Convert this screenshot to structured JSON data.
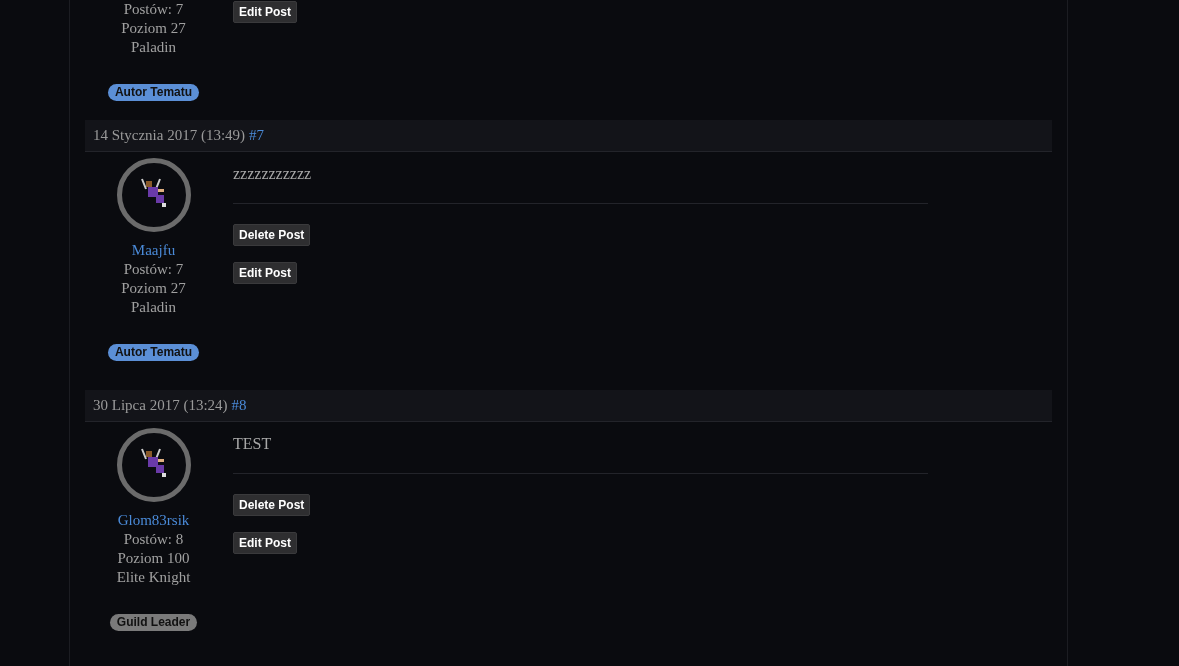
{
  "posts": [
    {
      "stats": [
        "Postów: 7",
        "Poziom 27",
        "Paladin"
      ],
      "badge": {
        "label": "Autor Tematu",
        "color": "#5b8fd6"
      },
      "actions": [
        "Edit Post"
      ]
    },
    {
      "date": "14 Stycznia 2017 (13:49)",
      "number": "#7",
      "author": "Maajfu",
      "stats": [
        "Postów: 7",
        "Poziom 27",
        "Paladin"
      ],
      "badge": {
        "label": "Autor Tematu",
        "color": "#5b8fd6"
      },
      "body": "zzzzzzzzzzz",
      "actions": [
        "Delete Post",
        "Edit Post"
      ]
    },
    {
      "date": "30 Lipca 2017 (13:24)",
      "number": "#8",
      "author": "Glom83rsik",
      "stats": [
        "Postów: 8",
        "Poziom 100",
        "Elite Knight"
      ],
      "badge": {
        "label": "Guild Leader",
        "color": "#7a7a7a"
      },
      "body": "TEST",
      "actions": [
        "Delete Post",
        "Edit Post"
      ]
    }
  ]
}
